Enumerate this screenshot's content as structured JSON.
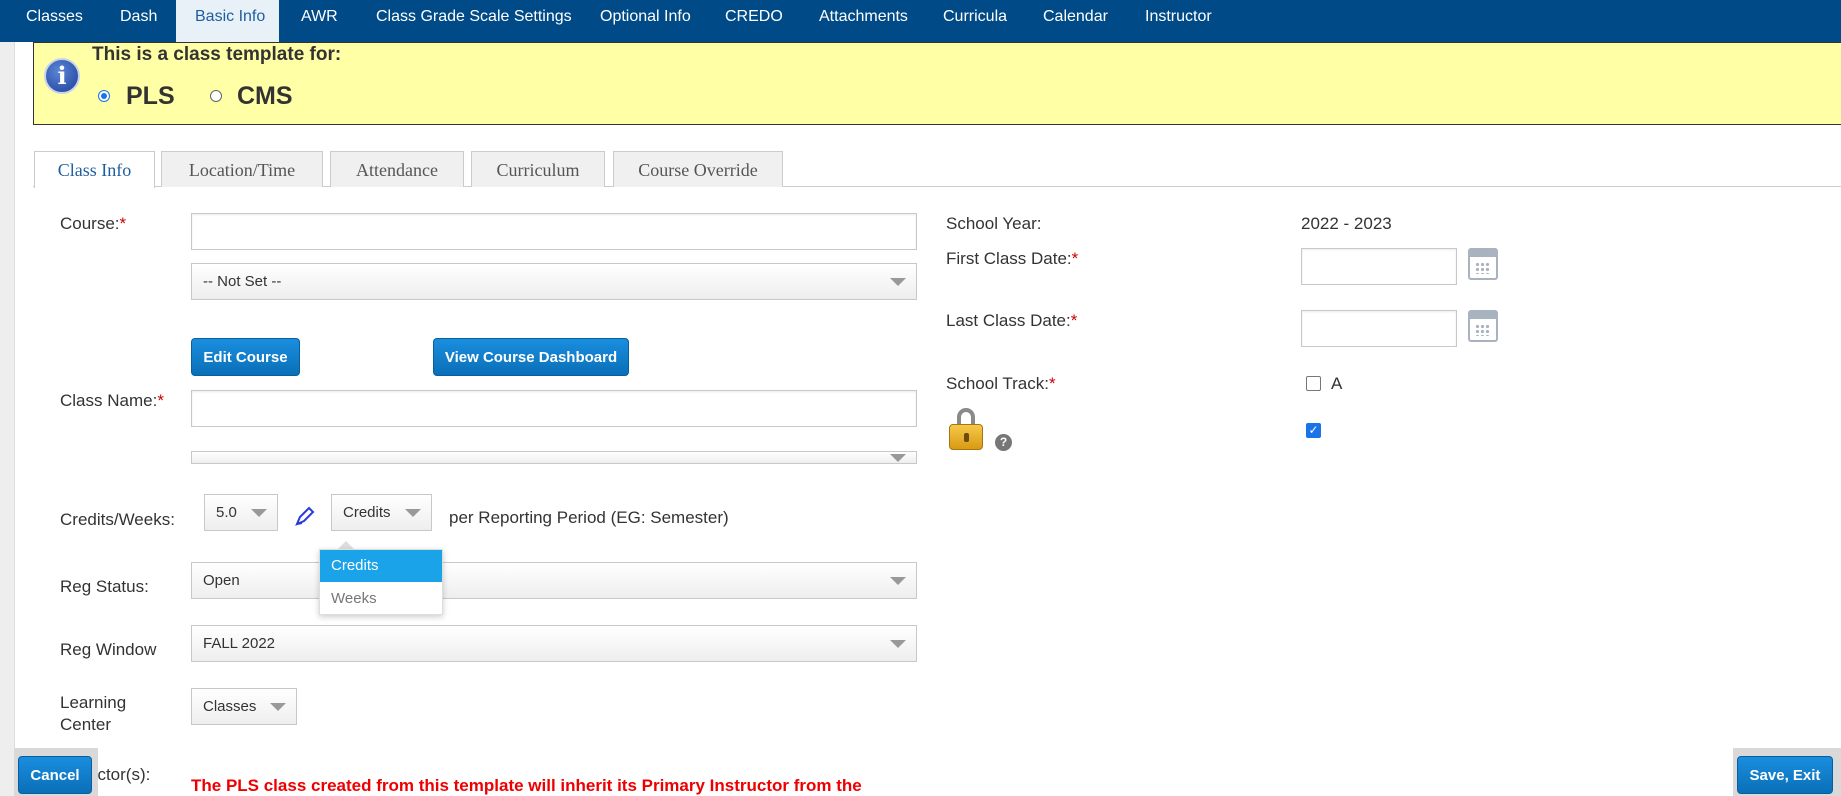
{
  "nav": {
    "tabs": [
      "Classes",
      "Dash",
      "Basic Info",
      "AWR",
      "Class Grade Scale Settings",
      "Optional Info",
      "CREDO",
      "Attachments",
      "Curricula",
      "Calendar",
      "Instructor"
    ],
    "active": "Basic Info"
  },
  "banner": {
    "title": "This is a class template for:",
    "options": [
      "PLS",
      "CMS"
    ],
    "selected": "PLS"
  },
  "subtabs": {
    "items": [
      "Class Info",
      "Location/Time",
      "Attendance",
      "Curriculum",
      "Course Override"
    ],
    "active": "Class Info"
  },
  "form": {
    "course_label": "Course:",
    "course_value": "",
    "course_select": "-- Not Set --",
    "edit_course_button": "Edit Course",
    "view_dashboard_button": "View Course Dashboard",
    "class_name_label": "Class Name:",
    "class_name_value": "",
    "credits_weeks_label": "Credits/Weeks:",
    "credits_value": "5.0",
    "unit_value": "Credits",
    "unit_options": [
      "Credits",
      "Weeks"
    ],
    "per_period_text": "per Reporting Period (EG: Semester)",
    "reg_status_label": "Reg Status:",
    "reg_status_value": "Open",
    "reg_window_label": "Reg Window",
    "reg_window_value": "FALL 2022",
    "learning_center_label": "Learning Center",
    "learning_center_value": "Classes",
    "instructors_label": "uctor(s):",
    "required_mark": "*"
  },
  "right": {
    "school_year_label": "School Year:",
    "school_year_value": "2022 - 2023",
    "first_class_date_label": "First Class Date:",
    "first_class_date_value": "",
    "last_class_date_label": "Last Class Date:",
    "last_class_date_value": "",
    "school_track_label": "School Track:",
    "track_option": "A",
    "track_checked": false,
    "lock_checked": true,
    "help_glyph": "?"
  },
  "warning_text": "The PLS class created from this template will inherit its Primary Instructor from the",
  "buttons": {
    "cancel": "Cancel",
    "save_exit": "Save, Exit"
  },
  "colors": {
    "nav_bg": "#004b87",
    "banner_bg": "#ffffa6",
    "button_blue": "#0a7ccc",
    "required_red": "#cc0000",
    "warning_red": "#ee0000"
  },
  "icons": [
    "info-icon",
    "calendar-icon",
    "lock-icon",
    "help-icon",
    "pencil-icon",
    "chevron-down-icon"
  ]
}
